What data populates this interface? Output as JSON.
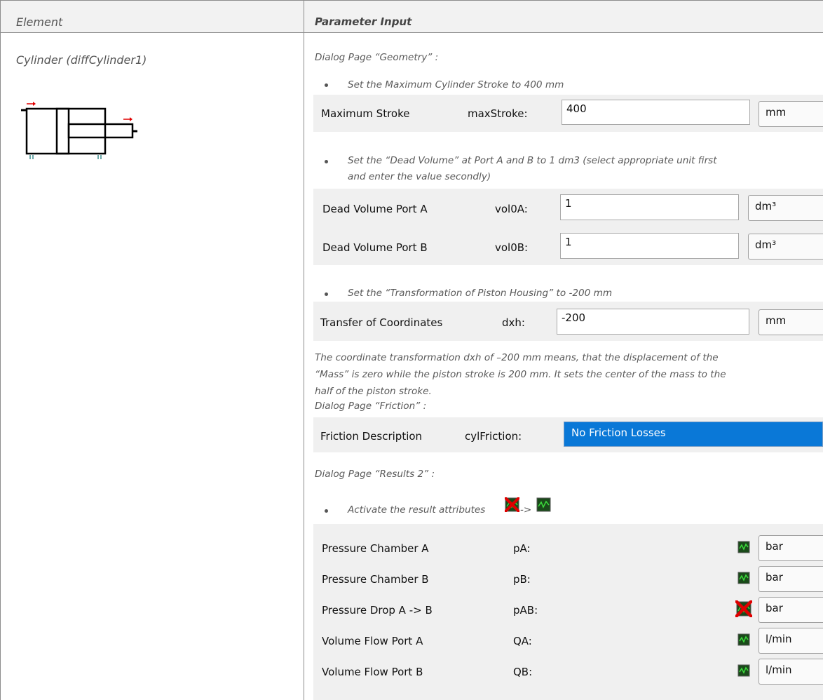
{
  "table": {
    "header": {
      "element": "Element",
      "parameter_input": "Parameter Input"
    },
    "element_name": "Cylinder (diffCylinder1)"
  },
  "dialog_geometry": {
    "page_title": "Dialog Page “Geometry” :",
    "bullet1": "Set the Maximum Cylinder Stroke to 400 mm",
    "max_stroke": {
      "label": "Maximum Stroke",
      "name": "maxStroke:",
      "value": "400",
      "unit": "mm"
    },
    "bullet2_line1": "Set the “Dead Volume” at Port A and B to 1 dm3 (select   appropriate unit first",
    "bullet2_line2": "and enter the value secondly)",
    "dead_volume_a": {
      "label": "Dead Volume Port A",
      "name": "vol0A:",
      "value": "1",
      "unit": "dm³"
    },
    "dead_volume_b": {
      "label": "Dead Volume Port B",
      "name": "vol0B:",
      "value": "1",
      "unit": "dm³"
    },
    "bullet3": "Set the “Transformation of Piston Housing” to -200 mm",
    "transfer": {
      "label": "Transfer of Coordinates",
      "name": "dxh:",
      "value": "-200",
      "unit": "mm"
    },
    "note_line1": "The coordinate transformation dxh of –200 mm means, that the displacement of the",
    "note_line2": "“Mass” is zero while the piston stroke is 200 mm. It sets the center of the mass to the",
    "note_line3": "half of the piston stroke."
  },
  "dialog_friction": {
    "page_title": "Dialog Page “Friction” :",
    "friction": {
      "label": "Friction Description",
      "name": "cylFriction:",
      "value": "No Friction Losses"
    }
  },
  "dialog_results": {
    "page_title": "Dialog Page “Results 2” :",
    "bullet_text": "Activate the result attributes",
    "bullet_arrow": "->",
    "rows": [
      {
        "label": "Pressure Chamber A",
        "name": "pA:",
        "icon": "active-plot-icon",
        "unit": "bar"
      },
      {
        "label": "Pressure Chamber B",
        "name": "pB:",
        "icon": "active-plot-icon",
        "unit": "bar"
      },
      {
        "label": "Pressure Drop A -> B",
        "name": "pAB:",
        "icon": "inactive-plot-icon",
        "unit": "bar"
      },
      {
        "label": "Volume Flow Port A",
        "name": "QA:",
        "icon": "active-plot-icon",
        "unit": "l/min"
      },
      {
        "label": "Volume Flow Port B",
        "name": "QB:",
        "icon": "active-plot-icon",
        "unit": "l/min"
      }
    ]
  },
  "colors": {
    "header_bg": "#f2f2f2",
    "panel_bg": "#f0f0f0",
    "selection_blue": "#0a78d7",
    "port_arrow": "#e00000"
  }
}
